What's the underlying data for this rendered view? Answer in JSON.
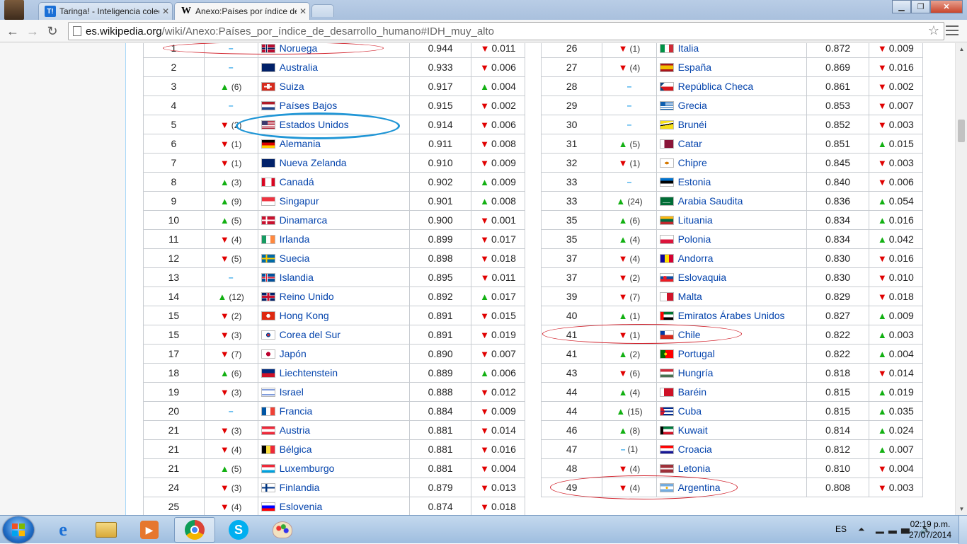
{
  "browser": {
    "tabs": [
      {
        "label": "Taringa! - Inteligencia colectiva",
        "favicon": "taringa-icon"
      },
      {
        "label": "Anexo:Países por índice de desarrollo humano",
        "favicon": "wikipedia-icon"
      }
    ],
    "url_domain": "es.wikipedia.org",
    "url_path": "/wiki/Anexo:Países_por_índice_de_desarrollo_humano#IDH_muy_alto"
  },
  "table_left": [
    {
      "rank": "1",
      "dir": "same",
      "chg": "",
      "country": "Noruega",
      "flag": "norway",
      "hdi": "0.944",
      "ddir": "down",
      "delta": "0.011"
    },
    {
      "rank": "2",
      "dir": "same",
      "chg": "",
      "country": "Australia",
      "flag": "australia",
      "hdi": "0.933",
      "ddir": "down",
      "delta": "0.006"
    },
    {
      "rank": "3",
      "dir": "up",
      "chg": "(6)",
      "country": "Suiza",
      "flag": "switzerland",
      "hdi": "0.917",
      "ddir": "up",
      "delta": "0.004"
    },
    {
      "rank": "4",
      "dir": "same",
      "chg": "",
      "country": "Países Bajos",
      "flag": "netherlands",
      "hdi": "0.915",
      "ddir": "down",
      "delta": "0.002"
    },
    {
      "rank": "5",
      "dir": "down",
      "chg": "(2)",
      "country": "Estados Unidos",
      "flag": "usa",
      "hdi": "0.914",
      "ddir": "down",
      "delta": "0.006"
    },
    {
      "rank": "6",
      "dir": "down",
      "chg": "(1)",
      "country": "Alemania",
      "flag": "germany",
      "hdi": "0.911",
      "ddir": "down",
      "delta": "0.008"
    },
    {
      "rank": "7",
      "dir": "down",
      "chg": "(1)",
      "country": "Nueva Zelanda",
      "flag": "new-zealand",
      "hdi": "0.910",
      "ddir": "down",
      "delta": "0.009"
    },
    {
      "rank": "8",
      "dir": "up",
      "chg": "(3)",
      "country": "Canadá",
      "flag": "canada",
      "hdi": "0.902",
      "ddir": "up",
      "delta": "0.009"
    },
    {
      "rank": "9",
      "dir": "up",
      "chg": "(9)",
      "country": "Singapur",
      "flag": "singapore",
      "hdi": "0.901",
      "ddir": "up",
      "delta": "0.008"
    },
    {
      "rank": "10",
      "dir": "up",
      "chg": "(5)",
      "country": "Dinamarca",
      "flag": "denmark",
      "hdi": "0.900",
      "ddir": "down",
      "delta": "0.001"
    },
    {
      "rank": "11",
      "dir": "down",
      "chg": "(4)",
      "country": "Irlanda",
      "flag": "ireland",
      "hdi": "0.899",
      "ddir": "down",
      "delta": "0.017"
    },
    {
      "rank": "12",
      "dir": "down",
      "chg": "(5)",
      "country": "Suecia",
      "flag": "sweden",
      "hdi": "0.898",
      "ddir": "down",
      "delta": "0.018"
    },
    {
      "rank": "13",
      "dir": "same",
      "chg": "",
      "country": "Islandia",
      "flag": "iceland",
      "hdi": "0.895",
      "ddir": "down",
      "delta": "0.011"
    },
    {
      "rank": "14",
      "dir": "up",
      "chg": "(12)",
      "country": "Reino Unido",
      "flag": "uk",
      "hdi": "0.892",
      "ddir": "up",
      "delta": "0.017"
    },
    {
      "rank": "15",
      "dir": "down",
      "chg": "(2)",
      "country": "Hong Kong",
      "flag": "hong-kong",
      "hdi": "0.891",
      "ddir": "down",
      "delta": "0.015"
    },
    {
      "rank": "15",
      "dir": "down",
      "chg": "(3)",
      "country": "Corea del Sur",
      "flag": "south-korea",
      "hdi": "0.891",
      "ddir": "down",
      "delta": "0.019"
    },
    {
      "rank": "17",
      "dir": "down",
      "chg": "(7)",
      "country": "Japón",
      "flag": "japan",
      "hdi": "0.890",
      "ddir": "down",
      "delta": "0.007"
    },
    {
      "rank": "18",
      "dir": "up",
      "chg": "(6)",
      "country": "Liechtenstein",
      "flag": "liechtenstein",
      "hdi": "0.889",
      "ddir": "up",
      "delta": "0.006"
    },
    {
      "rank": "19",
      "dir": "down",
      "chg": "(3)",
      "country": "Israel",
      "flag": "israel",
      "hdi": "0.888",
      "ddir": "down",
      "delta": "0.012"
    },
    {
      "rank": "20",
      "dir": "same",
      "chg": "",
      "country": "Francia",
      "flag": "france",
      "hdi": "0.884",
      "ddir": "down",
      "delta": "0.009"
    },
    {
      "rank": "21",
      "dir": "down",
      "chg": "(3)",
      "country": "Austria",
      "flag": "austria",
      "hdi": "0.881",
      "ddir": "down",
      "delta": "0.014"
    },
    {
      "rank": "21",
      "dir": "down",
      "chg": "(4)",
      "country": "Bélgica",
      "flag": "belgium",
      "hdi": "0.881",
      "ddir": "down",
      "delta": "0.016"
    },
    {
      "rank": "21",
      "dir": "up",
      "chg": "(5)",
      "country": "Luxemburgo",
      "flag": "luxembourg",
      "hdi": "0.881",
      "ddir": "down",
      "delta": "0.004"
    },
    {
      "rank": "24",
      "dir": "down",
      "chg": "(3)",
      "country": "Finlandia",
      "flag": "finland",
      "hdi": "0.879",
      "ddir": "down",
      "delta": "0.013"
    },
    {
      "rank": "25",
      "dir": "down",
      "chg": "(4)",
      "country": "Eslovenia",
      "flag": "slovenia",
      "hdi": "0.874",
      "ddir": "down",
      "delta": "0.018"
    }
  ],
  "table_right": [
    {
      "rank": "26",
      "dir": "down",
      "chg": "(1)",
      "country": "Italia",
      "flag": "italy",
      "hdi": "0.872",
      "ddir": "down",
      "delta": "0.009"
    },
    {
      "rank": "27",
      "dir": "down",
      "chg": "(4)",
      "country": "España",
      "flag": "spain",
      "hdi": "0.869",
      "ddir": "down",
      "delta": "0.016"
    },
    {
      "rank": "28",
      "dir": "same",
      "chg": "",
      "country": "República Checa",
      "flag": "czech",
      "hdi": "0.861",
      "ddir": "down",
      "delta": "0.002"
    },
    {
      "rank": "29",
      "dir": "same",
      "chg": "",
      "country": "Grecia",
      "flag": "greece",
      "hdi": "0.853",
      "ddir": "down",
      "delta": "0.007"
    },
    {
      "rank": "30",
      "dir": "same",
      "chg": "",
      "country": "Brunéi",
      "flag": "brunei",
      "hdi": "0.852",
      "ddir": "down",
      "delta": "0.003"
    },
    {
      "rank": "31",
      "dir": "up",
      "chg": "(5)",
      "country": "Catar",
      "flag": "qatar",
      "hdi": "0.851",
      "ddir": "up",
      "delta": "0.015"
    },
    {
      "rank": "32",
      "dir": "down",
      "chg": "(1)",
      "country": "Chipre",
      "flag": "cyprus",
      "hdi": "0.845",
      "ddir": "down",
      "delta": "0.003"
    },
    {
      "rank": "33",
      "dir": "same",
      "chg": "",
      "country": "Estonia",
      "flag": "estonia",
      "hdi": "0.840",
      "ddir": "down",
      "delta": "0.006"
    },
    {
      "rank": "33",
      "dir": "up",
      "chg": "(24)",
      "country": "Arabia Saudita",
      "flag": "saudi-arabia",
      "hdi": "0.836",
      "ddir": "up",
      "delta": "0.054"
    },
    {
      "rank": "35",
      "dir": "up",
      "chg": "(6)",
      "country": "Lituania",
      "flag": "lithuania",
      "hdi": "0.834",
      "ddir": "up",
      "delta": "0.016"
    },
    {
      "rank": "35",
      "dir": "up",
      "chg": "(4)",
      "country": "Polonia",
      "flag": "poland",
      "hdi": "0.834",
      "ddir": "up",
      "delta": "0.042"
    },
    {
      "rank": "37",
      "dir": "down",
      "chg": "(4)",
      "country": "Andorra",
      "flag": "andorra",
      "hdi": "0.830",
      "ddir": "down",
      "delta": "0.016"
    },
    {
      "rank": "37",
      "dir": "down",
      "chg": "(2)",
      "country": "Eslovaquia",
      "flag": "slovakia",
      "hdi": "0.830",
      "ddir": "down",
      "delta": "0.010"
    },
    {
      "rank": "39",
      "dir": "down",
      "chg": "(7)",
      "country": "Malta",
      "flag": "malta",
      "hdi": "0.829",
      "ddir": "down",
      "delta": "0.018"
    },
    {
      "rank": "40",
      "dir": "up",
      "chg": "(1)",
      "country": "Emiratos Árabes Unidos",
      "flag": "uae",
      "hdi": "0.827",
      "ddir": "up",
      "delta": "0.009"
    },
    {
      "rank": "41",
      "dir": "down",
      "chg": "(1)",
      "country": "Chile",
      "flag": "chile",
      "hdi": "0.822",
      "ddir": "up",
      "delta": "0.003"
    },
    {
      "rank": "41",
      "dir": "up",
      "chg": "(2)",
      "country": "Portugal",
      "flag": "portugal",
      "hdi": "0.822",
      "ddir": "up",
      "delta": "0.004"
    },
    {
      "rank": "43",
      "dir": "down",
      "chg": "(6)",
      "country": "Hungría",
      "flag": "hungary",
      "hdi": "0.818",
      "ddir": "down",
      "delta": "0.014"
    },
    {
      "rank": "44",
      "dir": "up",
      "chg": "(4)",
      "country": "Baréin",
      "flag": "bahrain",
      "hdi": "0.815",
      "ddir": "up",
      "delta": "0.019"
    },
    {
      "rank": "44",
      "dir": "up",
      "chg": "(15)",
      "country": "Cuba",
      "flag": "cuba",
      "hdi": "0.815",
      "ddir": "up",
      "delta": "0.035"
    },
    {
      "rank": "46",
      "dir": "up",
      "chg": "(8)",
      "country": "Kuwait",
      "flag": "kuwait",
      "hdi": "0.814",
      "ddir": "up",
      "delta": "0.024"
    },
    {
      "rank": "47",
      "dir": "same",
      "chg": "(1)",
      "country": "Croacia",
      "flag": "croatia",
      "hdi": "0.812",
      "ddir": "up",
      "delta": "0.007"
    },
    {
      "rank": "48",
      "dir": "down",
      "chg": "(4)",
      "country": "Letonia",
      "flag": "latvia",
      "hdi": "0.810",
      "ddir": "down",
      "delta": "0.004"
    },
    {
      "rank": "49",
      "dir": "down",
      "chg": "(4)",
      "country": "Argentina",
      "flag": "argentina",
      "hdi": "0.808",
      "ddir": "down",
      "delta": "0.003"
    }
  ],
  "taskbar": {
    "lang": "ES",
    "time": "02:19 p.m.",
    "date": "27/07/2014",
    "apps": [
      "internet-explorer-icon",
      "file-explorer-icon",
      "media-player-icon",
      "chrome-icon",
      "skype-icon",
      "paint-icon"
    ]
  },
  "colors": {
    "up": "#12b012",
    "down": "#e00000",
    "same": "#2ba3e8",
    "link": "#0645ad"
  }
}
